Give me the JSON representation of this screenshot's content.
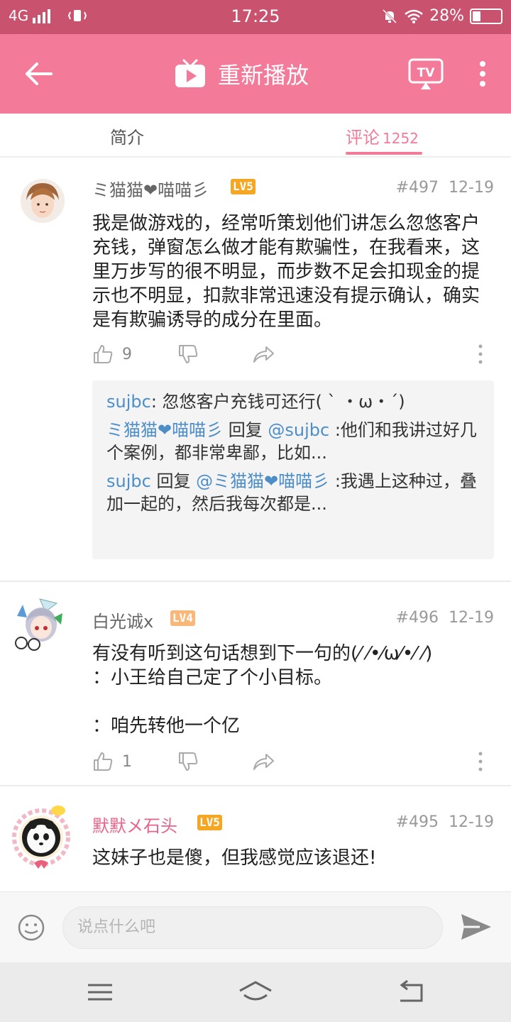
{
  "status_bar": {
    "network": "4G",
    "time": "17:25",
    "battery": "28%"
  },
  "app_bar": {
    "title": "重新播放",
    "icons": [
      "back-arrow-icon",
      "tv-logo-icon",
      "cast-tv-icon",
      "more-vertical-icon"
    ]
  },
  "tabs": {
    "intro": "简介",
    "comments": "评论",
    "comments_count": "1252"
  },
  "comments": [
    {
      "username": "ミ猫猫❤喵喵彡",
      "level": "LV5",
      "floor": "#497",
      "date": "12-19",
      "content": "我是做游戏的，经常听策划他们讲怎么忽悠客户充钱，弹窗怎么做才能有欺骗性，在我看来，这里万步写的很不明显，而步数不足会扣现金的提示也不明显，扣款非常迅速没有提示确认，确实是有欺骗诱导的成分在里面。",
      "likes": "9",
      "replies": [
        {
          "name": "sujbc",
          "text": ": 忽悠客户充钱可还行( ` ・ω・´)"
        },
        {
          "name": "ミ猫猫❤喵喵彡",
          "verb": " 回复 ",
          "target": "@sujbc",
          "text": " :他们和我讲过好几个案例，都非常卑鄙，比如..."
        },
        {
          "name": "sujbc",
          "verb": " 回复 ",
          "target": "@ミ猫猫❤喵喵彡",
          "text": " :我遇上这种过，叠加一起的，然后我每次都是..."
        }
      ]
    },
    {
      "username": "白光诚x",
      "level": "LV4",
      "floor": "#496",
      "date": "12-19",
      "content": "有没有听到这句话想到下一句的(⁄ ⁄•⁄ω⁄•⁄ ⁄)\n：小王给自己定了个小目标。\n\n：咱先转他一个亿",
      "likes": "1"
    },
    {
      "username": "默默メ石头",
      "level": "LV5",
      "floor": "#495",
      "date": "12-19",
      "content": "这妹子也是傻，但我感觉应该退还!"
    }
  ],
  "input_bar": {
    "placeholder": "说点什么吧"
  },
  "colors": {
    "status_bar": "#c9526f",
    "app_bar": "#f47a9a",
    "accent": "#f47a9a",
    "level_badge": "#f5a623",
    "reply_name": "#4d8ec9",
    "vip_name": "#e8638a"
  }
}
